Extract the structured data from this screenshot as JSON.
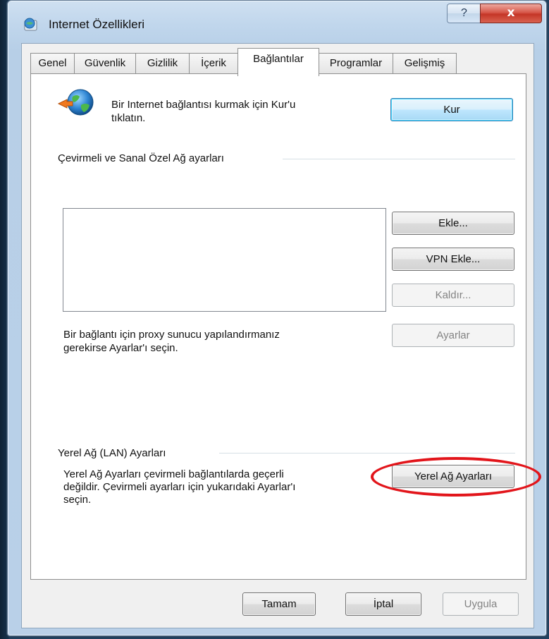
{
  "window": {
    "title": "Internet Özellikleri",
    "help_glyph": "?",
    "close_glyph": "x"
  },
  "tabs": [
    {
      "label": "Genel"
    },
    {
      "label": "Güvenlik"
    },
    {
      "label": "Gizlilik"
    },
    {
      "label": "İçerik"
    },
    {
      "label": "Bağlantılar",
      "active": true
    },
    {
      "label": "Programlar"
    },
    {
      "label": "Gelişmiş"
    }
  ],
  "setup": {
    "line1": "Bir Internet bağlantısı kurmak için Kur'u",
    "line2": "tıklatın.",
    "button": "Kur"
  },
  "dialup": {
    "group_label": "Çevirmeli ve Sanal Özel Ağ ayarları",
    "add_button": "Ekle...",
    "add_vpn_button": "VPN Ekle...",
    "remove_button": "Kaldır...",
    "settings_button": "Ayarlar",
    "proxy_line1": "Bir bağlantı için proxy sunucu yapılandırmanız",
    "proxy_line2": "gerekirse Ayarlar'ı seçin."
  },
  "lan": {
    "group_label": "Yerel Ağ (LAN) Ayarları",
    "desc_line1": "Yerel Ağ Ayarları çevirmeli bağlantılarda geçerli",
    "desc_line2": "değildir. Çevirmeli ayarları için yukarıdaki Ayarlar'ı",
    "desc_line3": "seçin.",
    "button": "Yerel Ağ Ayarları"
  },
  "footer": {
    "ok": "Tamam",
    "cancel": "İptal",
    "apply": "Uygula"
  },
  "colors": {
    "highlight_ellipse": "#e2151b",
    "close_button": "#c43527",
    "title_gradient": "#c0d6ec"
  },
  "icons": {
    "title": "internet-options-icon",
    "setup": "globe-connect-icon"
  }
}
